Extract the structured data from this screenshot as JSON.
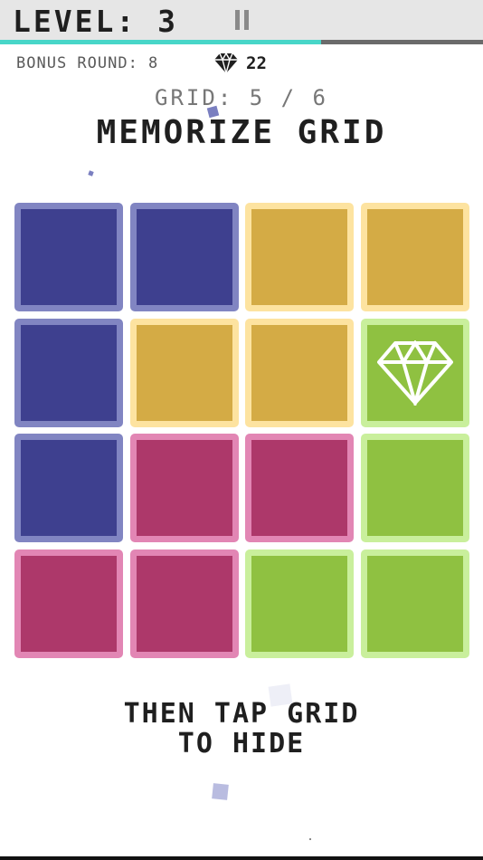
{
  "header": {
    "level_text": "LEVEL: 3"
  },
  "progress": {
    "fraction": 0.665,
    "track_color": "#6b6b6b",
    "fill_color": "#48d6c8"
  },
  "status": {
    "bonus_text": "BONUS ROUND: 8",
    "gems": "22"
  },
  "grid_counter": "GRID: 5 / 6",
  "heading": "MEMORIZE GRID",
  "hint": {
    "line1": "THEN TAP GRID",
    "line2": "TO HIDE"
  },
  "colors": {
    "blue": {
      "fill": "#3e408f",
      "border": "#8185c2"
    },
    "yellow": {
      "fill": "#d4ab45",
      "border": "#fde3a0"
    },
    "pink": {
      "fill": "#ad386a",
      "border": "#e286b4"
    },
    "green": {
      "fill": "#8fc141",
      "border": "#c9ef9c"
    }
  },
  "tiles": [
    [
      "blue",
      "blue",
      "yellow",
      "yellow"
    ],
    [
      "blue",
      "yellow",
      "yellow",
      "green"
    ],
    [
      "blue",
      "pink",
      "pink",
      "green"
    ],
    [
      "pink",
      "pink",
      "green",
      "green"
    ]
  ],
  "gem_tile": {
    "row": 1,
    "col": 3,
    "icon": "diamond-icon"
  }
}
